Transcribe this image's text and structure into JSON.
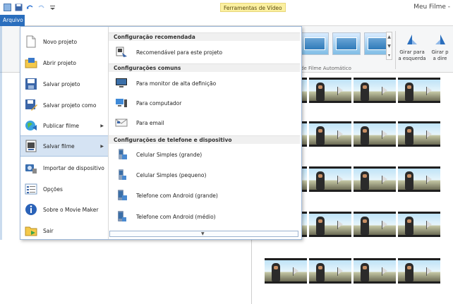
{
  "titlebar": {
    "contextual_tab": "Ferramentas de Vídeo",
    "window_title": "Meu Filme -"
  },
  "ribbon": {
    "file_tab": "Arquivo",
    "group_label": "de Filme Automático",
    "rotate_left": "Girar para\na esquerda",
    "rotate_right": "Girar p\na dire"
  },
  "menu": {
    "items": [
      {
        "label": "Novo projeto",
        "icon": "new-project-icon"
      },
      {
        "label": "Abrir projeto",
        "icon": "open-project-icon"
      },
      {
        "label": "Salvar projeto",
        "icon": "save-project-icon"
      },
      {
        "label": "Salvar projeto como",
        "icon": "save-project-as-icon"
      },
      {
        "label": "Publicar filme",
        "icon": "publish-movie-icon"
      },
      {
        "label": "Salvar filme",
        "icon": "save-movie-icon"
      },
      {
        "label": "Importar de dispositivo",
        "icon": "import-device-icon"
      },
      {
        "label": "Opções",
        "icon": "options-icon"
      },
      {
        "label": "Sobre o Movie Maker",
        "icon": "about-icon"
      },
      {
        "label": "Sair",
        "icon": "exit-icon"
      }
    ]
  },
  "panel": {
    "sections": [
      {
        "title": "Configuração recomendada"
      },
      {
        "title": "Configurações comuns"
      },
      {
        "title": "Configurações de telefone e dispositivo"
      }
    ],
    "items": [
      {
        "label": "Recomendável para este projeto",
        "icon": "recommended-icon"
      },
      {
        "label": "Para monitor de alta definição",
        "icon": "hd-monitor-icon"
      },
      {
        "label": "Para computador",
        "icon": "computer-icon"
      },
      {
        "label": "Para email",
        "icon": "email-icon"
      },
      {
        "label": "Celular Simples (grande)",
        "icon": "phone-icon"
      },
      {
        "label": "Celular Simples (pequeno)",
        "icon": "phone-icon"
      },
      {
        "label": "Telefone com Android (grande)",
        "icon": "android-phone-icon"
      },
      {
        "label": "Telefone com Android (médio)",
        "icon": "android-phone-icon"
      }
    ]
  },
  "colors": {
    "accent": "#2a6ebd",
    "contextual": "#fbf0a0",
    "selected": "#d5e3f3"
  }
}
